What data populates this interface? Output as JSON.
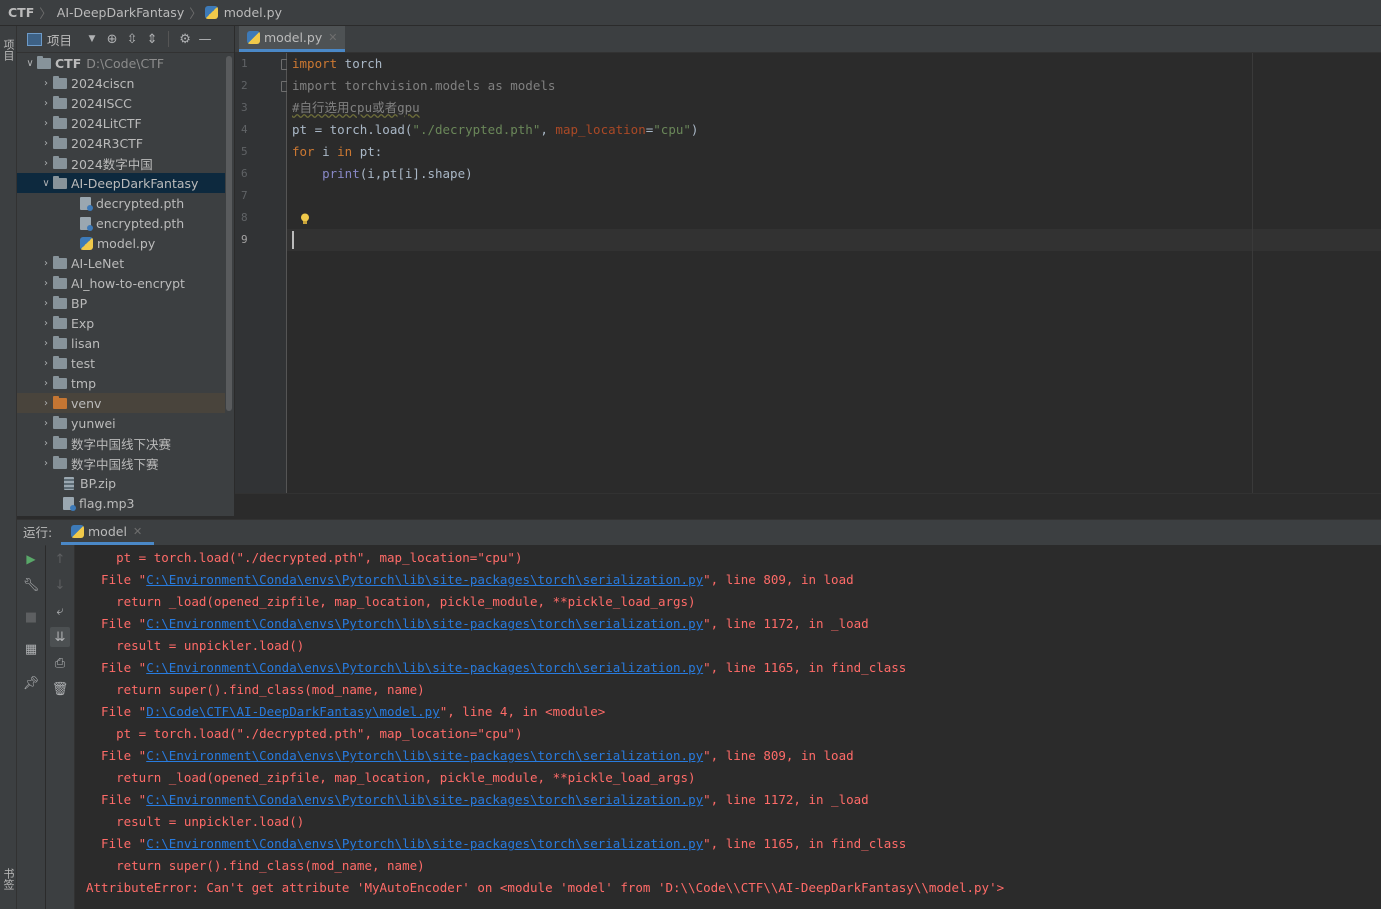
{
  "breadcrumb": {
    "root": "CTF",
    "folder": "AI-DeepDarkFantasy",
    "file": "model.py"
  },
  "left_stripe": {
    "project_tab": "项目",
    "bookmarks_tab": "书签"
  },
  "project_toolbar": {
    "label": "项目"
  },
  "tree": {
    "root": {
      "name": "CTF",
      "path": "D:\\Code\\CTF"
    },
    "items": [
      {
        "label": "2024ciscn",
        "kind": "folder"
      },
      {
        "label": "2024ISCC",
        "kind": "folder"
      },
      {
        "label": "2024LitCTF",
        "kind": "folder"
      },
      {
        "label": "2024R3CTF",
        "kind": "folder"
      },
      {
        "label": "2024数字中国",
        "kind": "folder"
      },
      {
        "label": "AI-DeepDarkFantasy",
        "kind": "folder-open"
      },
      {
        "label": "decrypted.pth",
        "kind": "data"
      },
      {
        "label": "encrypted.pth",
        "kind": "data"
      },
      {
        "label": "model.py",
        "kind": "python"
      },
      {
        "label": "AI-LeNet",
        "kind": "folder"
      },
      {
        "label": "AI_how-to-encrypt",
        "kind": "folder"
      },
      {
        "label": "BP",
        "kind": "folder"
      },
      {
        "label": "Exp",
        "kind": "folder"
      },
      {
        "label": "lisan",
        "kind": "folder"
      },
      {
        "label": "test",
        "kind": "folder"
      },
      {
        "label": "tmp",
        "kind": "folder"
      },
      {
        "label": "venv",
        "kind": "folder-excluded"
      },
      {
        "label": "yunwei",
        "kind": "folder"
      },
      {
        "label": "数字中国线下决赛",
        "kind": "folder"
      },
      {
        "label": "数字中国线下赛",
        "kind": "folder"
      },
      {
        "label": "BP.zip",
        "kind": "zip"
      },
      {
        "label": "flag.mp3",
        "kind": "data"
      }
    ]
  },
  "editor": {
    "tab_label": "model.py",
    "line_numbers": [
      "1",
      "2",
      "3",
      "4",
      "5",
      "6",
      "7",
      "8",
      "9"
    ],
    "code": {
      "l1_kw": "import",
      "l1_rest": " torch",
      "l2_kw": "import",
      "l2_rest": " torchvision.models as models",
      "l3_comment": "#自行选用cpu或者gpu",
      "l4_a": "pt = torch.load(",
      "l4_s1": "\"./decrypted.pth\"",
      "l4_b": ", ",
      "l4_p": "map_location",
      "l4_c": "=",
      "l4_s2": "\"cpu\"",
      "l4_d": ")",
      "l5_kw1": "for",
      "l5_a": " i ",
      "l5_kw2": "in",
      "l5_b": " pt:",
      "l6_fn": "print",
      "l6_rest": "(i,pt[i].shape)"
    }
  },
  "run": {
    "label": "运行:",
    "tab": "model",
    "console": [
      {
        "pre": "    pt = torch.load(\"./decrypted.pth\", map_location=\"cpu\")"
      },
      {
        "pre": "  File \"",
        "link": "C:\\Environment\\Conda\\envs\\Pytorch\\lib\\site-packages\\torch\\serialization.py",
        "post": "\", line 809, in load"
      },
      {
        "pre": "    return _load(opened_zipfile, map_location, pickle_module, **pickle_load_args)"
      },
      {
        "pre": "  File \"",
        "link": "C:\\Environment\\Conda\\envs\\Pytorch\\lib\\site-packages\\torch\\serialization.py",
        "post": "\", line 1172, in _load"
      },
      {
        "pre": "    result = unpickler.load()"
      },
      {
        "pre": "  File \"",
        "link": "C:\\Environment\\Conda\\envs\\Pytorch\\lib\\site-packages\\torch\\serialization.py",
        "post": "\", line 1165, in find_class"
      },
      {
        "pre": "    return super().find_class(mod_name, name)"
      },
      {
        "pre": "  File \"",
        "link": "D:\\Code\\CTF\\AI-DeepDarkFantasy\\model.py",
        "post": "\", line 4, in <module>"
      },
      {
        "pre": "    pt = torch.load(\"./decrypted.pth\", map_location=\"cpu\")"
      },
      {
        "pre": "  File \"",
        "link": "C:\\Environment\\Conda\\envs\\Pytorch\\lib\\site-packages\\torch\\serialization.py",
        "post": "\", line 809, in load"
      },
      {
        "pre": "    return _load(opened_zipfile, map_location, pickle_module, **pickle_load_args)"
      },
      {
        "pre": "  File \"",
        "link": "C:\\Environment\\Conda\\envs\\Pytorch\\lib\\site-packages\\torch\\serialization.py",
        "post": "\", line 1172, in _load"
      },
      {
        "pre": "    result = unpickler.load()"
      },
      {
        "pre": "  File \"",
        "link": "C:\\Environment\\Conda\\envs\\Pytorch\\lib\\site-packages\\torch\\serialization.py",
        "post": "\", line 1165, in find_class"
      },
      {
        "pre": "    return super().find_class(mod_name, name)"
      },
      {
        "pre": "AttributeError: Can't get attribute 'MyAutoEncoder' on <module 'model' from 'D:\\\\Code\\\\CTF\\\\AI-DeepDarkFantasy\\\\model.py'>"
      }
    ]
  },
  "colors": {
    "accent": "#4a88c7",
    "error_text": "#ff6b68",
    "link": "#287bde",
    "keyword": "#cc7832",
    "string": "#6a8759"
  }
}
